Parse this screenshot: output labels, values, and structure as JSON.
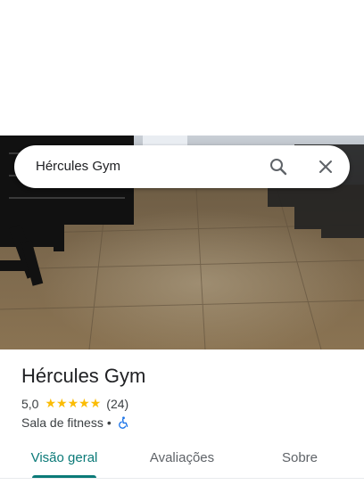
{
  "search": {
    "query": "Hércules Gym",
    "search_icon": "search-icon",
    "close_icon": "close-icon"
  },
  "place": {
    "name": "Hércules Gym",
    "rating": "5,0",
    "stars": 5,
    "review_count": "(24)",
    "category": "Sala de fitness",
    "separator": "•",
    "accessibility_icon": "wheelchair-icon"
  },
  "tabs": [
    {
      "label": "Visão geral",
      "active": true
    },
    {
      "label": "Avaliações",
      "active": false
    },
    {
      "label": "Sobre",
      "active": false
    }
  ],
  "colors": {
    "accent": "#0b7a78",
    "star": "#fbbc04",
    "accessibility": "#1a73e8"
  }
}
